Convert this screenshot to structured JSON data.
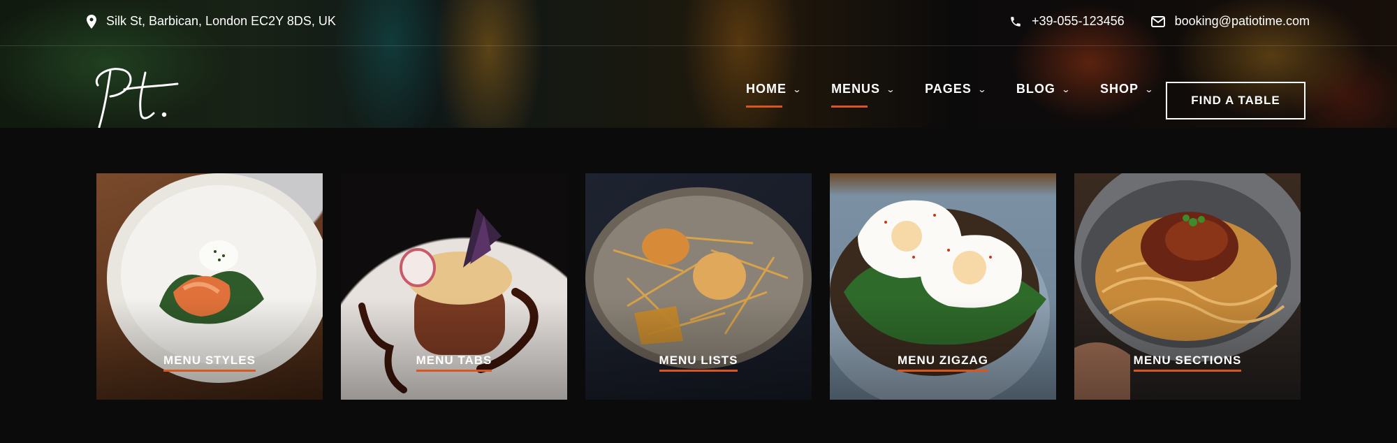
{
  "topbar": {
    "address": "Silk St, Barbican, London EC2Y 8DS, UK",
    "phone": "+39-055-123456",
    "email": "booking@patiotime.com"
  },
  "logo": {
    "text": "Pt."
  },
  "nav": {
    "items": [
      {
        "label": "HOME",
        "active": true
      },
      {
        "label": "MENUS",
        "active": true
      },
      {
        "label": "PAGES",
        "active": false
      },
      {
        "label": "BLOG",
        "active": false
      },
      {
        "label": "SHOP",
        "active": false
      }
    ],
    "cta": "FIND A TABLE"
  },
  "cards": [
    {
      "label": "MENU STYLES"
    },
    {
      "label": "MENU TABS"
    },
    {
      "label": "MENU LISTS"
    },
    {
      "label": "MENU ZIGZAG"
    },
    {
      "label": "MENU SECTIONS"
    }
  ],
  "colors": {
    "accent": "#d9571f",
    "background": "#0b0b0b"
  }
}
